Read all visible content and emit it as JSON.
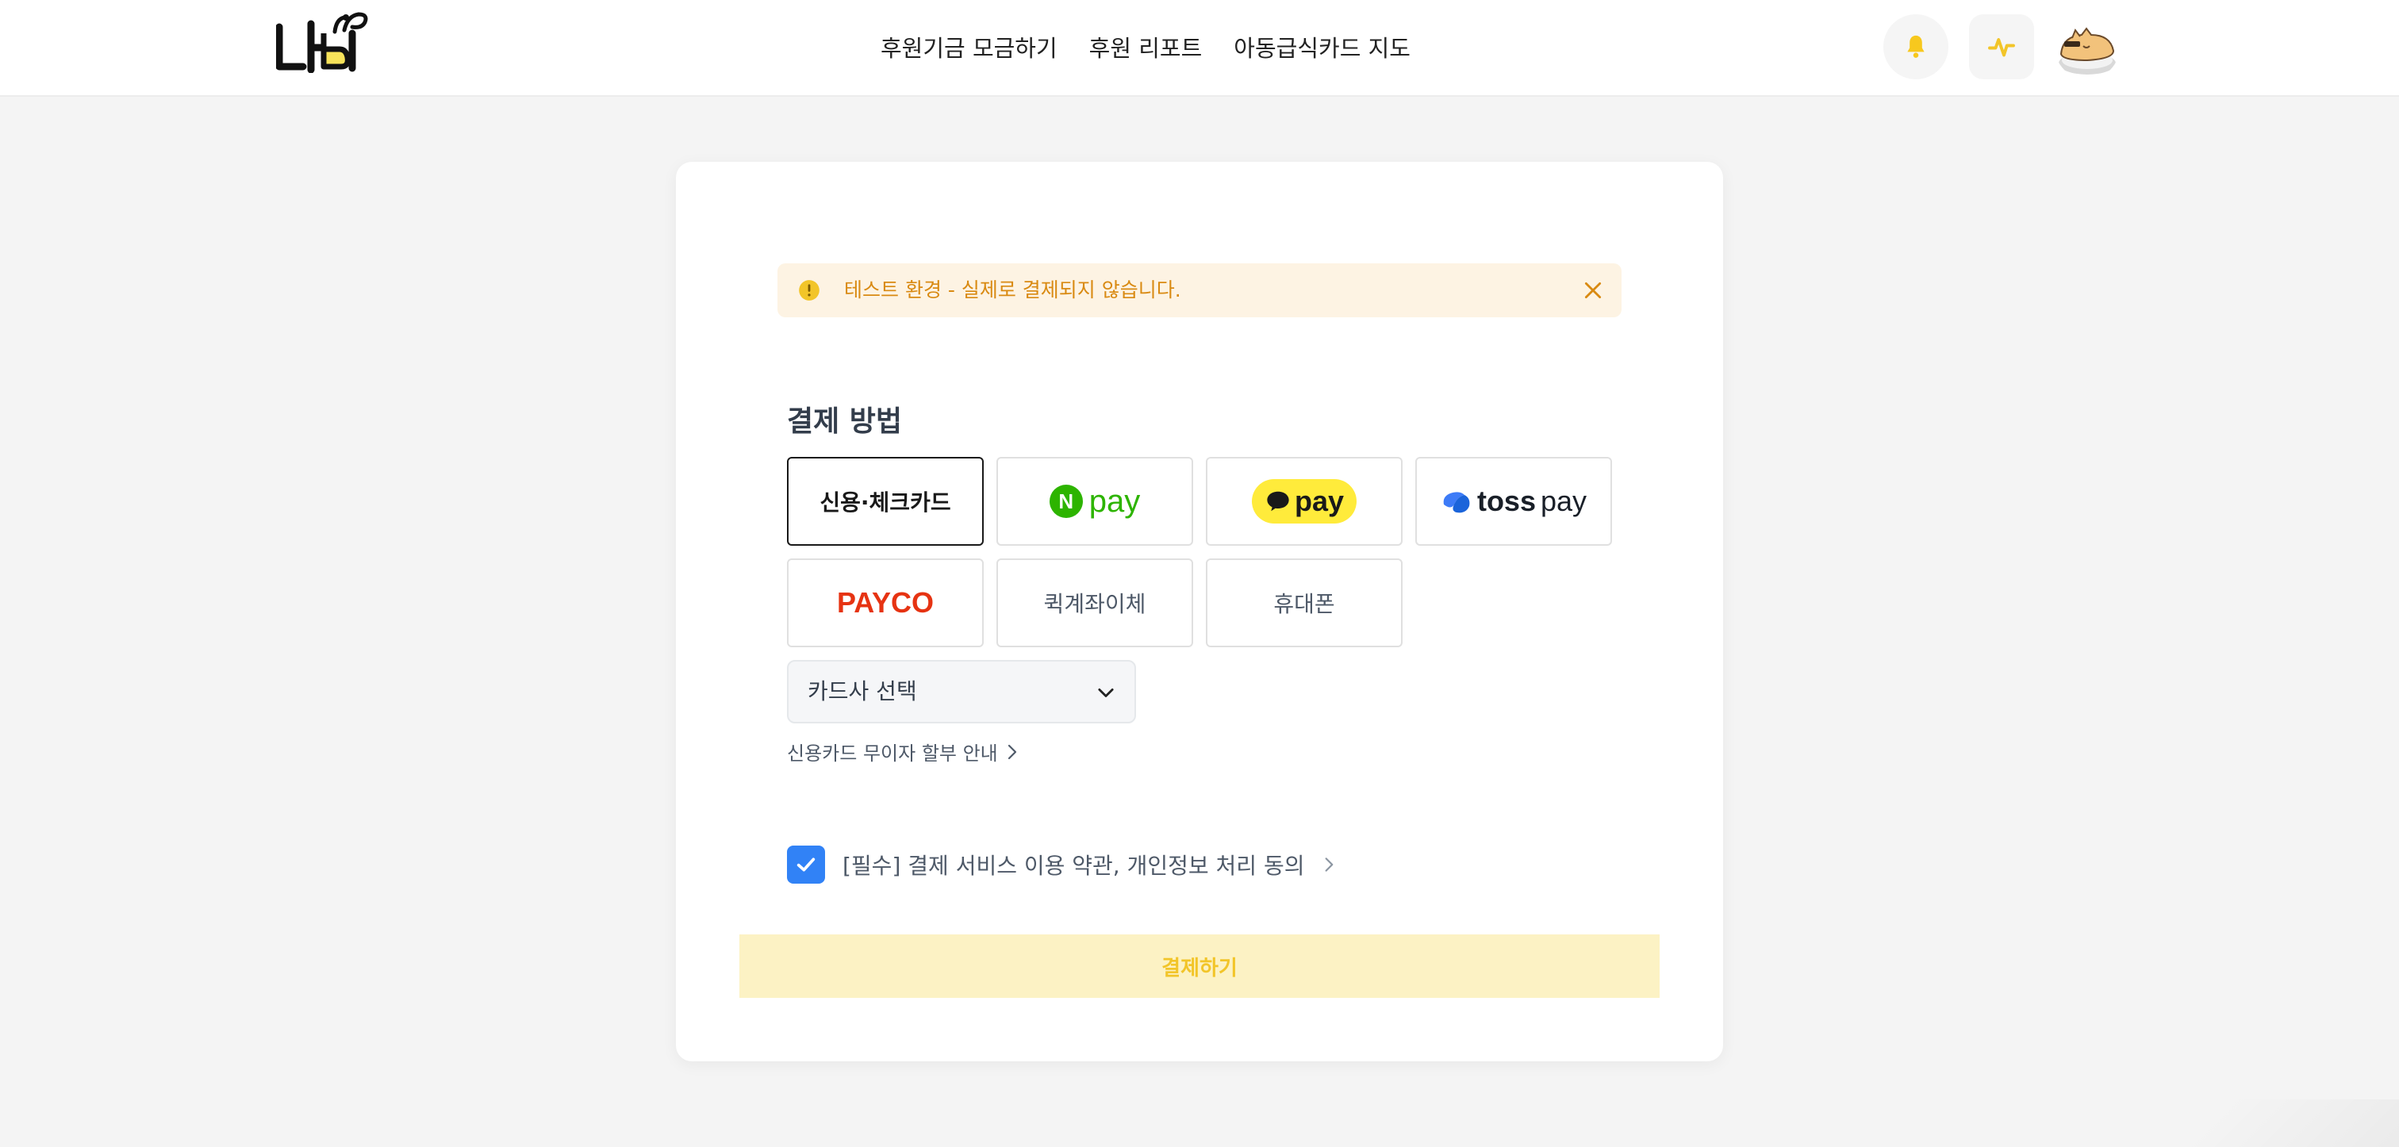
{
  "header": {
    "logo_text": "나비",
    "nav": [
      {
        "label": "후원기금 모금하기"
      },
      {
        "label": "후원 리포트"
      },
      {
        "label": "아동급식카드 지도"
      }
    ],
    "icons": [
      "bell-icon",
      "activity-icon",
      "avatar"
    ]
  },
  "colors": {
    "brand_yellow": "#f2c529",
    "alert_bg": "#fdf3e3",
    "alert_text": "#d98a12",
    "checkbox_blue": "#3182f6",
    "pay_button_bg": "#fcf2c4"
  },
  "alert": {
    "message": "테스트 환경 - 실제로 결제되지 않습니다."
  },
  "payment": {
    "section_title": "결제 방법",
    "methods": [
      {
        "label": "신용·체크카드",
        "selected": true
      },
      {
        "label": "N pay",
        "brand_n": "N",
        "brand_text": "pay"
      },
      {
        "label": "pay",
        "brand_text": "pay"
      },
      {
        "label": "toss pay",
        "brand_text": "toss",
        "brand_suffix": "pay"
      },
      {
        "label": "PAYCO"
      },
      {
        "label": "퀵계좌이체"
      },
      {
        "label": "휴대폰"
      }
    ],
    "card_select": {
      "selected_value": "카드사 선택"
    },
    "installment_link": "신용카드 무이자 할부 안내"
  },
  "agreement": {
    "checked": true,
    "label": "[필수] 결제 서비스 이용 약관, 개인정보 처리 동의"
  },
  "submit": {
    "label": "결제하기"
  }
}
